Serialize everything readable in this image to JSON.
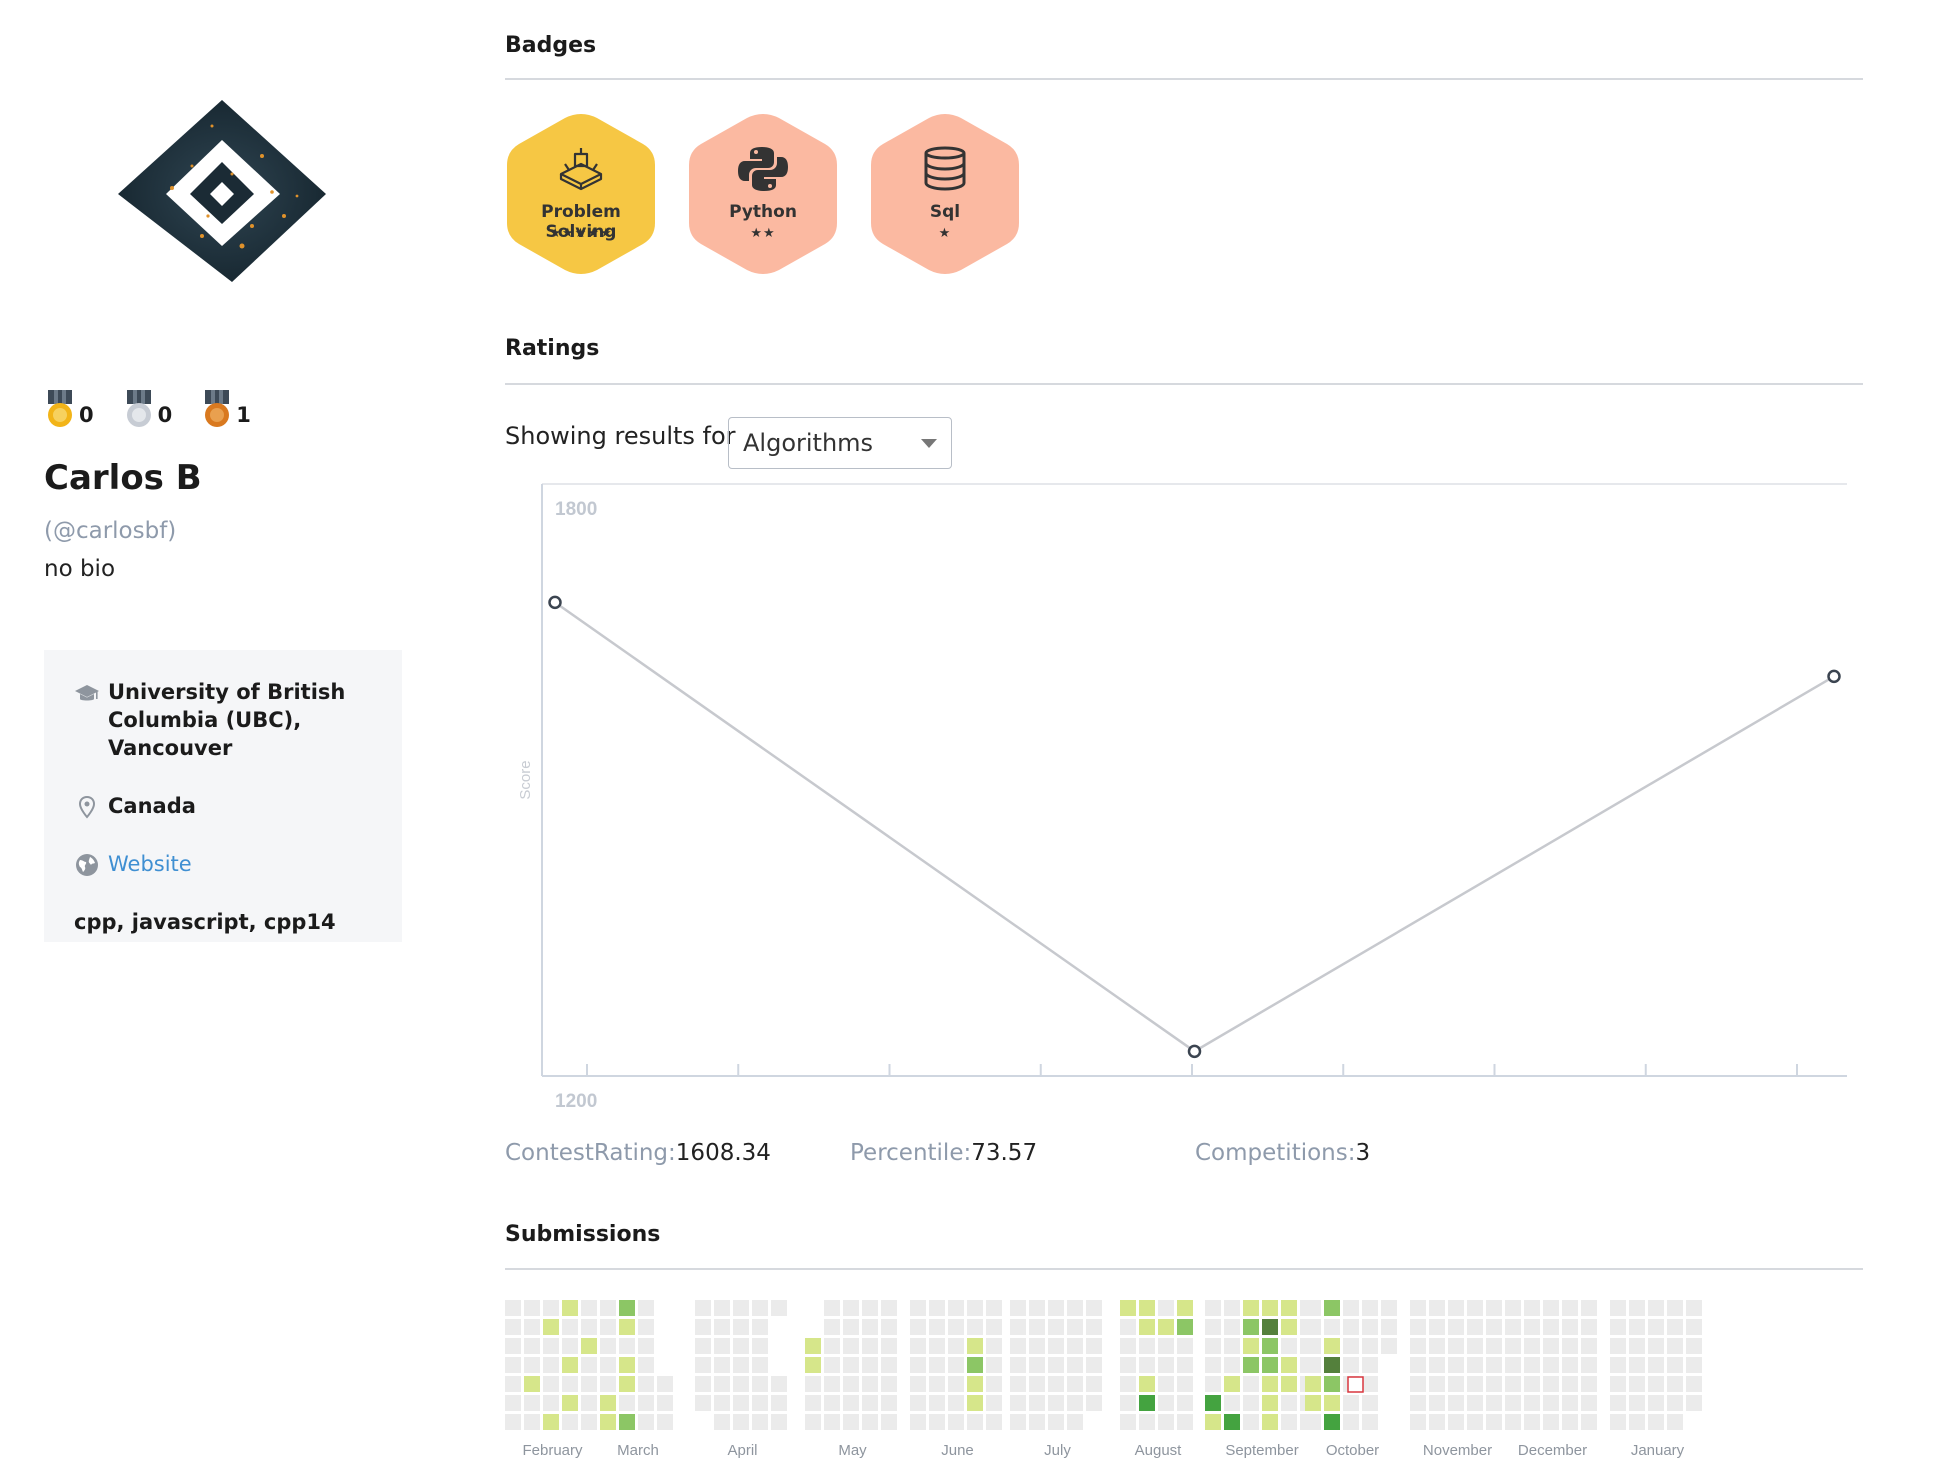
{
  "profile": {
    "name": "Carlos B",
    "handle": "(@carlosbf)",
    "bio": "no bio",
    "medals": [
      {
        "type": "gold",
        "count": "0",
        "color": "#f2b418"
      },
      {
        "type": "silver",
        "count": "0",
        "color": "#c7ccd4"
      },
      {
        "type": "bronze",
        "count": "1",
        "color": "#d9791f"
      }
    ],
    "school": "University of British Columbia (UBC), Vancouver",
    "country": "Canada",
    "website_label": "Website",
    "skills": "cpp, javascript, cpp14"
  },
  "sections": {
    "badges": "Badges",
    "ratings": "Ratings",
    "submissions": "Submissions"
  },
  "badges": [
    {
      "label": "Problem Solving",
      "stars": "★★★★★",
      "icon": "problem-solving-icon",
      "color": "#f6c744"
    },
    {
      "label": "Python",
      "stars": "★★",
      "icon": "python-icon",
      "color": "#fbb9a1"
    },
    {
      "label": "Sql",
      "stars": "★",
      "icon": "database-icon",
      "color": "#fbb9a1"
    }
  ],
  "ratings": {
    "filter_label": "Showing results for",
    "selected_track": "Algorithms",
    "stats": {
      "contest_rating_label": "ContestRating:",
      "contest_rating_value": "1608.34",
      "percentile_label": "Percentile:",
      "percentile_value": "73.57",
      "competitions_label": "Competitions:",
      "competitions_value": "3"
    }
  },
  "chart_data": {
    "type": "line",
    "ylabel": "Score",
    "ylim": [
      1200,
      1800
    ],
    "y_ticks": [
      "1800",
      "1200"
    ],
    "series": [
      {
        "values": [
          1680,
          1225,
          1605
        ]
      }
    ],
    "x_tick_count": 9,
    "line_color": "#c7c9ce"
  },
  "submissions": {
    "months": [
      "February",
      "March",
      "April",
      "May",
      "June",
      "July",
      "August",
      "September",
      "October",
      "November",
      "December",
      "January"
    ],
    "colors": {
      "0": "#ebebeb",
      "1": "#d6e68a",
      "2": "#8cc665",
      "3": "#44a340",
      "4": "#54803c"
    }
  }
}
